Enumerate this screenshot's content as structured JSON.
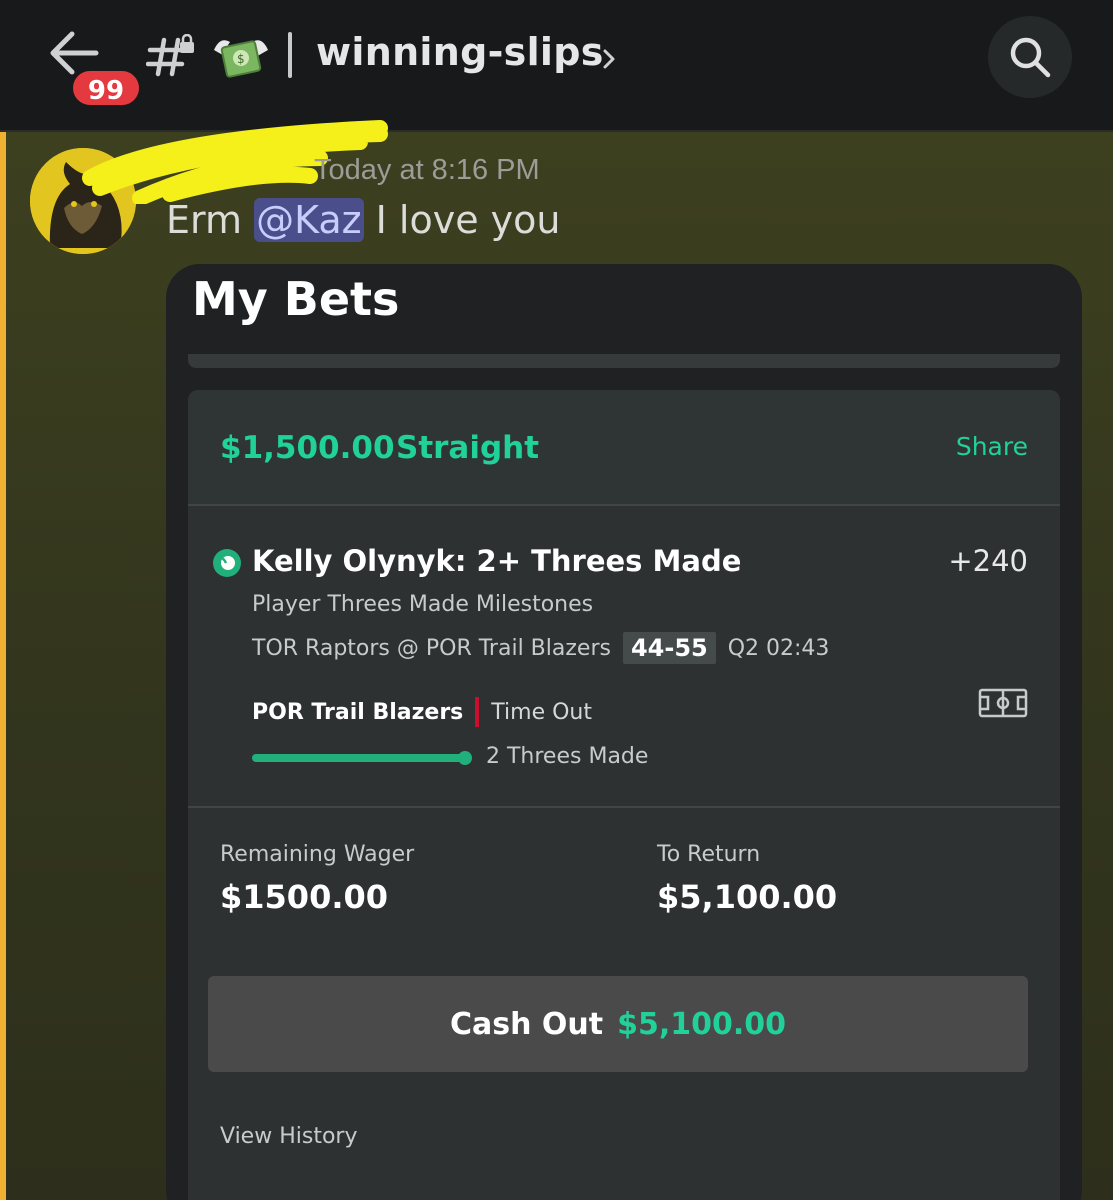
{
  "header": {
    "unread_count": "99",
    "channel_name": "winning-slips",
    "icons": {
      "back": "arrow-left-icon",
      "channel": "hash-lock-icon",
      "emoji": "money-with-wings-emoji",
      "chevron": "chevron-right-icon",
      "search": "search-icon"
    }
  },
  "message": {
    "timestamp": "Today at 8:16 PM",
    "text_before": "Erm ",
    "mention": "@Kaz",
    "text_after": " I love you"
  },
  "bet_card": {
    "title": "My Bets",
    "stake": "$1,500.00",
    "bet_type": "Straight",
    "share_label": "Share",
    "selection": {
      "name": "Kelly Olynyk: 2+ Threes Made",
      "odds": "+240",
      "market": "Player Threes Made Milestones",
      "matchup": "TOR Raptors @ POR Trail Blazers",
      "score": "44-55",
      "clock": "Q2 02:43",
      "live_team": "POR Trail Blazers",
      "live_event": "Time Out",
      "progress_label": "2 Threes Made",
      "progress_fraction": 1.0
    },
    "remaining_wager_label": "Remaining Wager",
    "remaining_wager_value": "$1500.00",
    "to_return_label": "To Return",
    "to_return_value": "$5,100.00",
    "cashout_label": "Cash Out",
    "cashout_amount": "$5,100.00",
    "view_history_label": "View History"
  },
  "colors": {
    "accent_green": "#21d19a",
    "mention_bar": "#f0b132",
    "badge_red": "#e3393f"
  }
}
